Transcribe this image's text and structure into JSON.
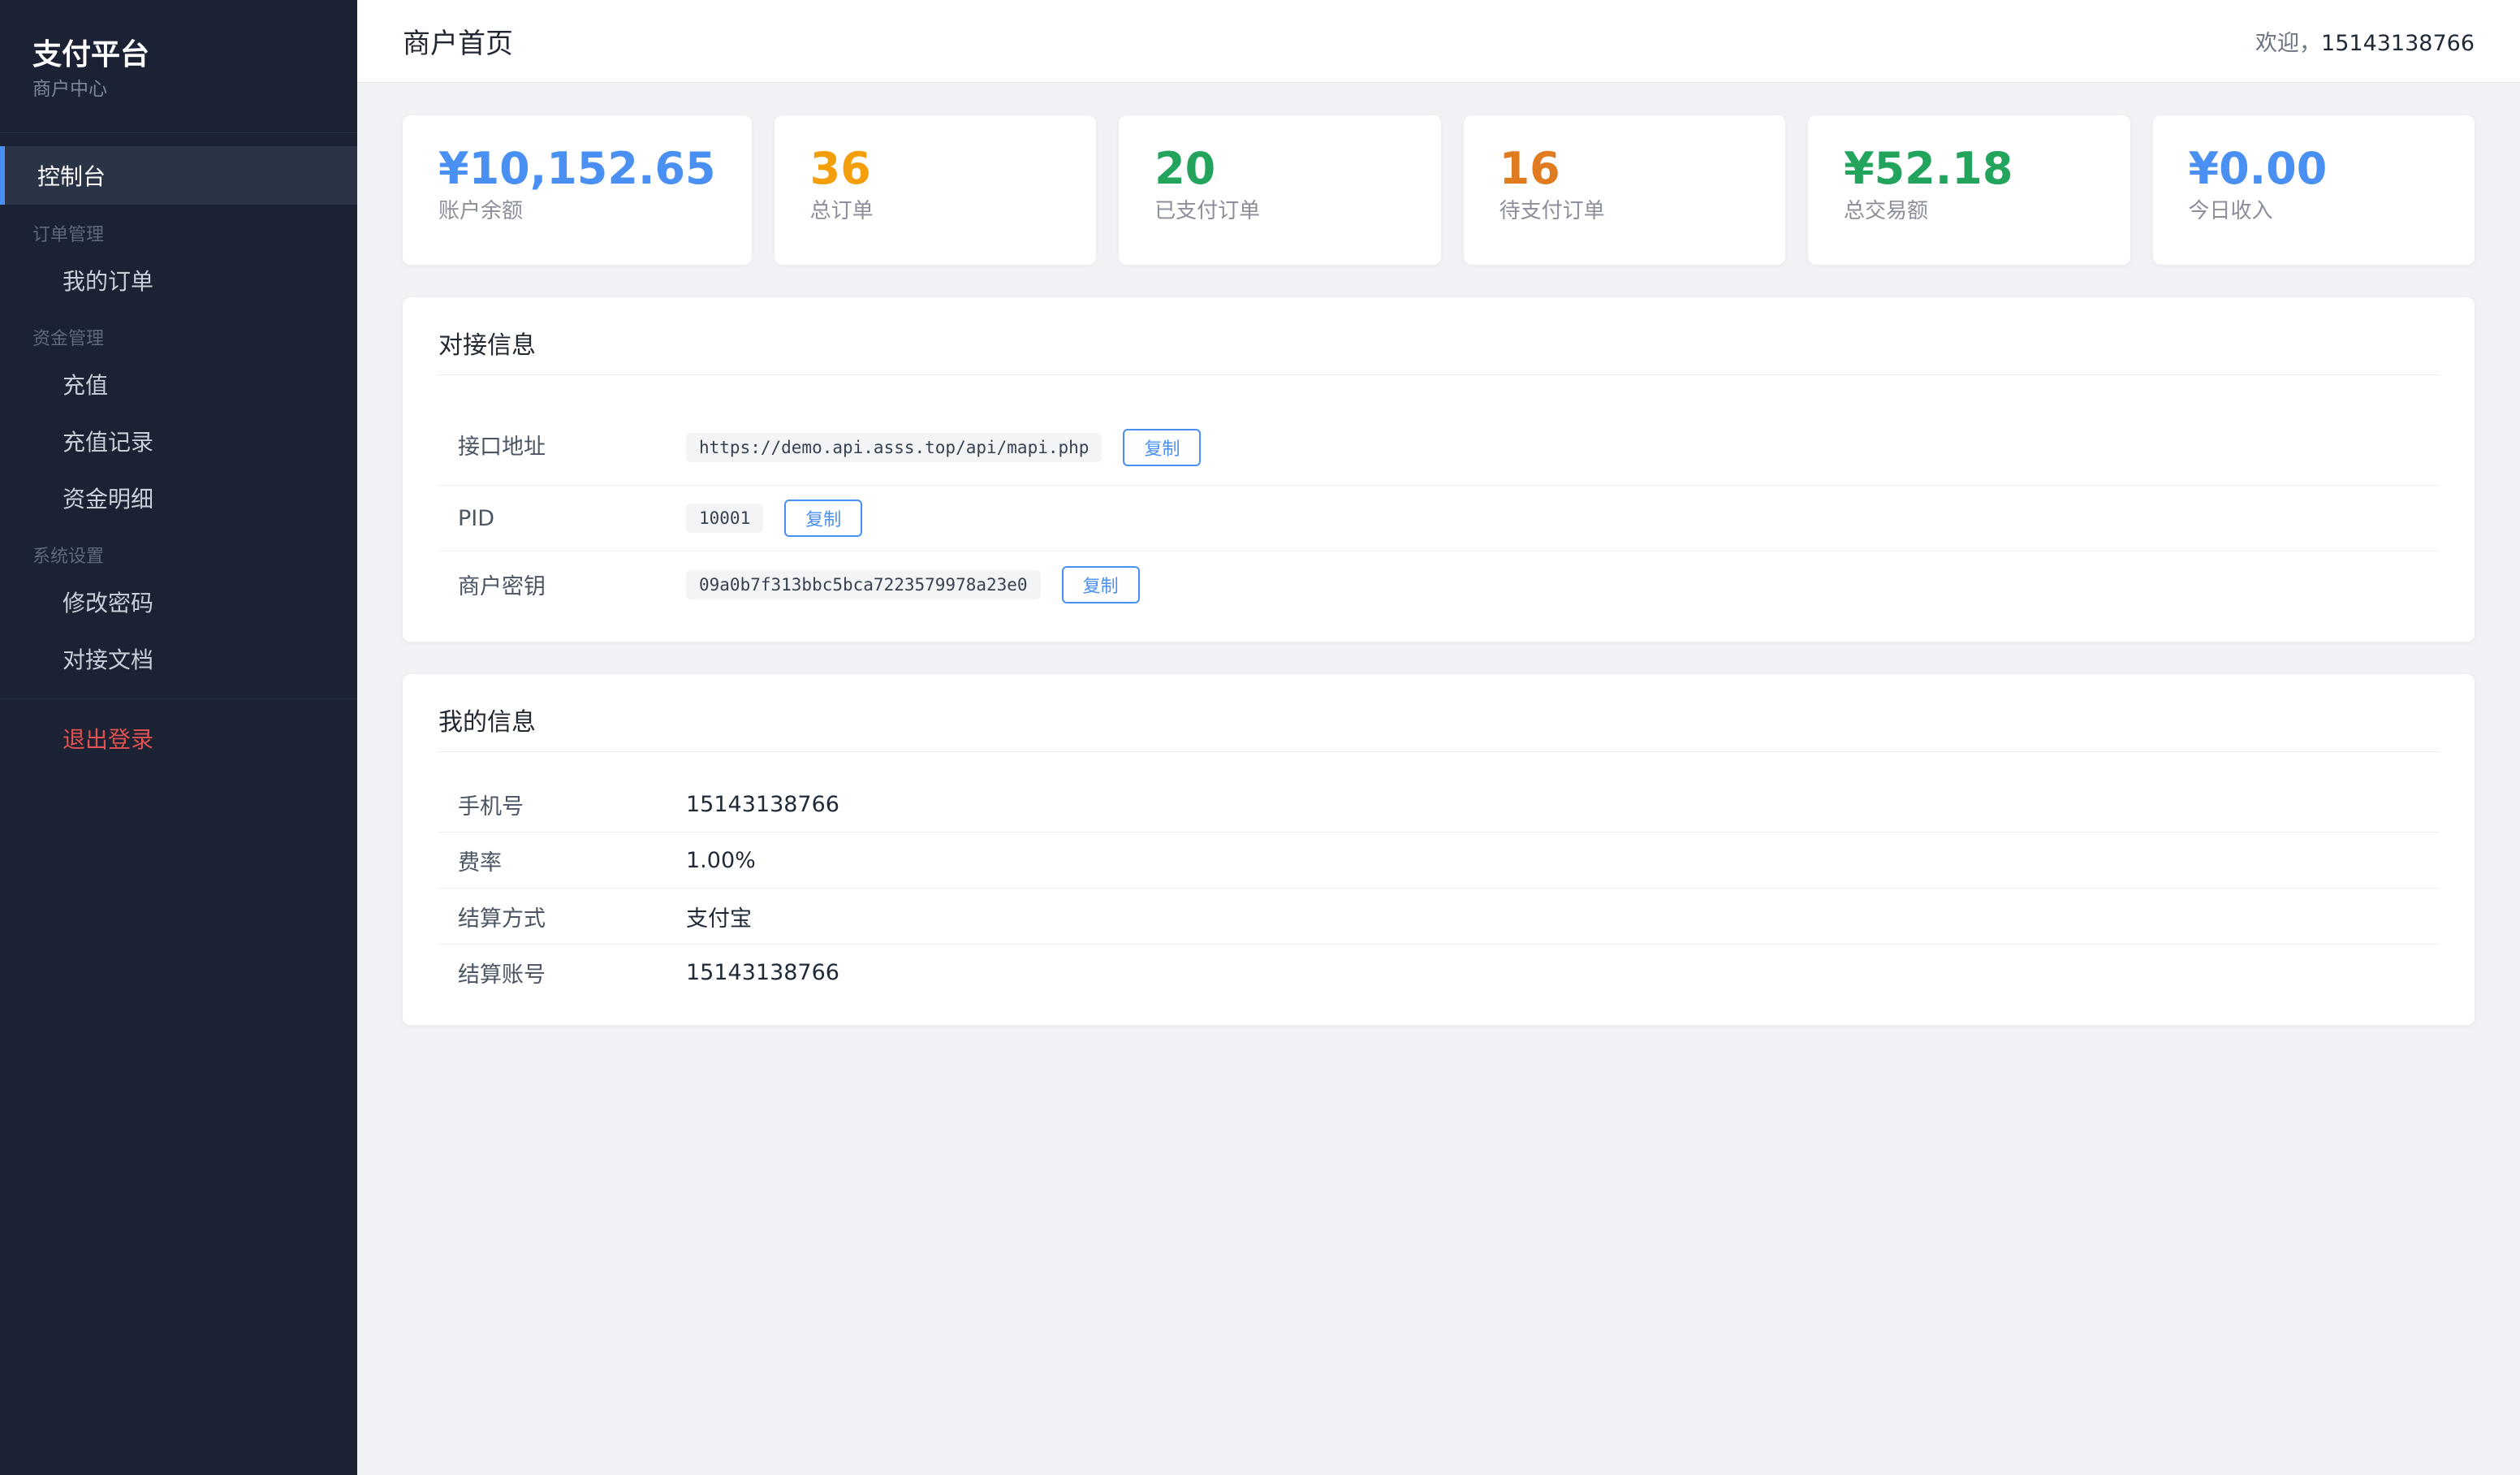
{
  "brand": {
    "title": "支付平台",
    "subtitle": "商户中心"
  },
  "sidebar": {
    "active": "控制台",
    "groups": [
      {
        "label": "订单管理",
        "items": [
          "我的订单"
        ]
      },
      {
        "label": "资金管理",
        "items": [
          "充值",
          "充值记录",
          "资金明细"
        ]
      },
      {
        "label": "系统设置",
        "items": [
          "修改密码",
          "对接文档"
        ]
      }
    ],
    "logout": "退出登录"
  },
  "header": {
    "title": "商户首页",
    "welcome_prefix": "欢迎，",
    "user": "15143138766"
  },
  "stats": [
    {
      "value": "¥10,152.65",
      "label": "账户余额",
      "color": "#4a90f2"
    },
    {
      "value": "36",
      "label": "总订单",
      "color": "#f59e0b"
    },
    {
      "value": "20",
      "label": "已支付订单",
      "color": "#22a45d"
    },
    {
      "value": "16",
      "label": "待支付订单",
      "color": "#e07b1f"
    },
    {
      "value": "¥52.18",
      "label": "总交易额",
      "color": "#22a45d"
    },
    {
      "value": "¥0.00",
      "label": "今日收入",
      "color": "#4a90f2"
    }
  ],
  "api_panel": {
    "title": "对接信息",
    "copy_label": "复制",
    "rows": [
      {
        "label": "接口地址",
        "value": "https://demo.api.asss.top/api/mapi.php"
      },
      {
        "label": "PID",
        "value": "10001"
      },
      {
        "label": "商户密钥",
        "value": "09a0b7f313bbc5bca7223579978a23e0"
      }
    ]
  },
  "info_panel": {
    "title": "我的信息",
    "rows": [
      {
        "label": "手机号",
        "value": "15143138766"
      },
      {
        "label": "费率",
        "value": "1.00%"
      },
      {
        "label": "结算方式",
        "value": "支付宝"
      },
      {
        "label": "结算账号",
        "value": "15143138766"
      }
    ]
  }
}
